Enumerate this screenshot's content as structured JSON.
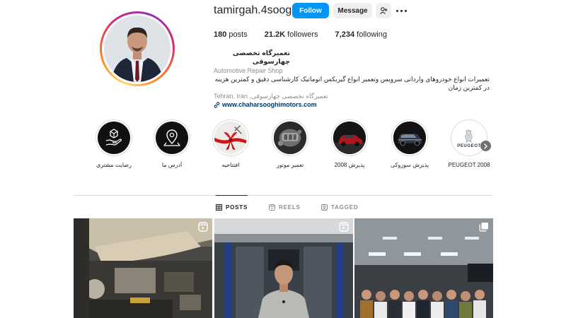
{
  "profile": {
    "username": "tamirgah.4sooghi",
    "follow_label": "Follow",
    "message_label": "Message",
    "stats": {
      "posts_count": "180",
      "posts_label": "posts",
      "followers_count": "21.2K",
      "followers_label": "followers",
      "following_count": "7,234",
      "following_label": "following"
    },
    "bio": {
      "name": "تعمیرگاه تخصصی چهارسوقی",
      "category": "Automotive Repair Shop",
      "description": "تعمیرات انواع خودروهای وارداتی سرویس وتعمیر انواع گیربکس اتوماتیک کارشناسی دقیق و کمترین هزینه در کمترین زمان",
      "location": "Tehran, Iran ,تعمیرگاه تخصصی چهارسوقی",
      "link": "www.chaharsooghimotors.com"
    }
  },
  "highlights": [
    {
      "label": "رضایت مشتری",
      "icon": "hand-box-icon"
    },
    {
      "label": "آدرس ما",
      "icon": "location-pin-icon"
    },
    {
      "label": "افتتاحیه",
      "icon": "ribbon-icon"
    },
    {
      "label": "تعمیر موتور",
      "icon": "engine-icon"
    },
    {
      "label": "پذیرش 2008",
      "icon": "red-car-icon"
    },
    {
      "label": "پذیرش سوزوکی",
      "icon": "suv-car-icon"
    },
    {
      "label": "PEUGEOT 2008",
      "icon": "peugeot-logo-icon",
      "logo_text": "PEUGEOT"
    }
  ],
  "tabs": [
    {
      "label": "POSTS",
      "icon": "grid-icon",
      "active": true
    },
    {
      "label": "REELS",
      "icon": "reels-icon",
      "active": false
    },
    {
      "label": "TAGGED",
      "icon": "tagged-icon",
      "active": false
    }
  ],
  "posts": [
    {
      "type": "reel",
      "icon": "reel-badge-icon"
    },
    {
      "type": "reel",
      "icon": "reel-badge-icon"
    },
    {
      "type": "carousel",
      "icon": "carousel-badge-icon"
    }
  ],
  "colors": {
    "accent": "#0095f6",
    "link": "#00376b",
    "muted": "#8e8e8e"
  }
}
